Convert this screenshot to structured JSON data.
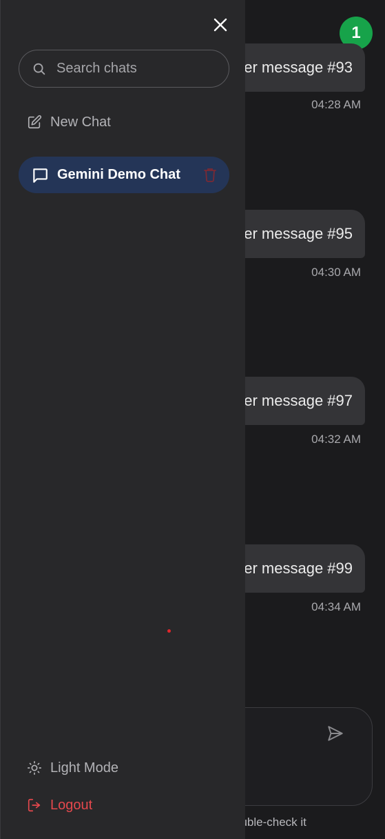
{
  "sidebar": {
    "search": {
      "placeholder": "Search chats",
      "value": ""
    },
    "new_chat_label": "New Chat",
    "chats": [
      {
        "title": "Gemini Demo Chat",
        "active": true
      }
    ],
    "light_mode_label": "Light Mode",
    "logout_label": "Logout"
  },
  "chat": {
    "notification_count": "1",
    "messages": [
      {
        "text": "er message #93",
        "time": "04:28 AM"
      },
      {
        "text": "er message #95",
        "time": "04:30 AM"
      },
      {
        "text": "er message #97",
        "time": "04:32 AM"
      },
      {
        "text": "er message #99",
        "time": "04:34 AM"
      }
    ],
    "disclaimer": "ouble-check it"
  },
  "colors": {
    "sidebar_bg": "#28282a",
    "active_chat_bg": "#243557",
    "badge": "#17a34a",
    "logout": "#e5484d",
    "bubble": "#343437"
  },
  "icons": [
    "close-icon",
    "search-icon",
    "edit-icon",
    "chat-bubble-icon",
    "trash-icon",
    "sun-icon",
    "logout-icon",
    "send-icon"
  ]
}
